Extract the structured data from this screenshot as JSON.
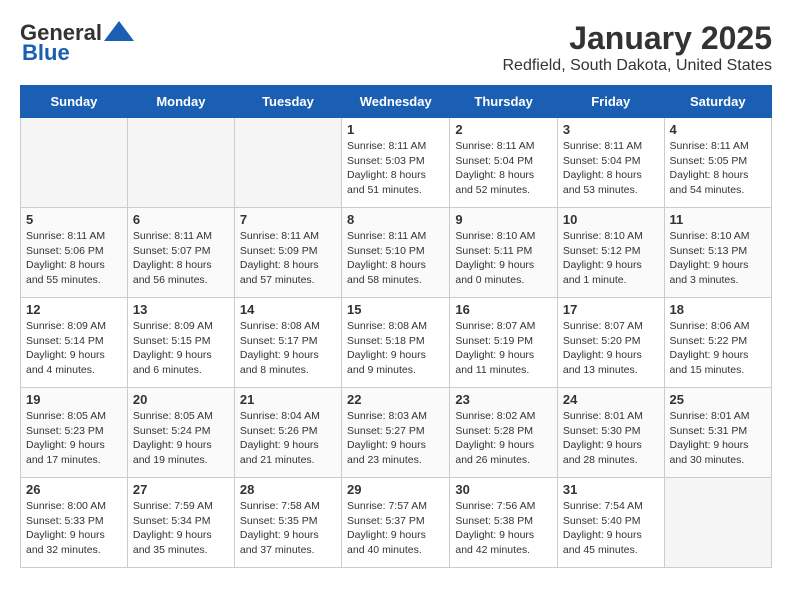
{
  "logo": {
    "text_general": "General",
    "text_blue": "Blue"
  },
  "header": {
    "title": "January 2025",
    "subtitle": "Redfield, South Dakota, United States"
  },
  "weekdays": [
    "Sunday",
    "Monday",
    "Tuesday",
    "Wednesday",
    "Thursday",
    "Friday",
    "Saturday"
  ],
  "weeks": [
    [
      {
        "day": "",
        "empty": true
      },
      {
        "day": "",
        "empty": true
      },
      {
        "day": "",
        "empty": true
      },
      {
        "day": "1",
        "sunrise": "8:11 AM",
        "sunset": "5:03 PM",
        "daylight": "8 hours and 51 minutes."
      },
      {
        "day": "2",
        "sunrise": "8:11 AM",
        "sunset": "5:04 PM",
        "daylight": "8 hours and 52 minutes."
      },
      {
        "day": "3",
        "sunrise": "8:11 AM",
        "sunset": "5:04 PM",
        "daylight": "8 hours and 53 minutes."
      },
      {
        "day": "4",
        "sunrise": "8:11 AM",
        "sunset": "5:05 PM",
        "daylight": "8 hours and 54 minutes."
      }
    ],
    [
      {
        "day": "5",
        "sunrise": "8:11 AM",
        "sunset": "5:06 PM",
        "daylight": "8 hours and 55 minutes."
      },
      {
        "day": "6",
        "sunrise": "8:11 AM",
        "sunset": "5:07 PM",
        "daylight": "8 hours and 56 minutes."
      },
      {
        "day": "7",
        "sunrise": "8:11 AM",
        "sunset": "5:09 PM",
        "daylight": "8 hours and 57 minutes."
      },
      {
        "day": "8",
        "sunrise": "8:11 AM",
        "sunset": "5:10 PM",
        "daylight": "8 hours and 58 minutes."
      },
      {
        "day": "9",
        "sunrise": "8:10 AM",
        "sunset": "5:11 PM",
        "daylight": "9 hours and 0 minutes."
      },
      {
        "day": "10",
        "sunrise": "8:10 AM",
        "sunset": "5:12 PM",
        "daylight": "9 hours and 1 minute."
      },
      {
        "day": "11",
        "sunrise": "8:10 AM",
        "sunset": "5:13 PM",
        "daylight": "9 hours and 3 minutes."
      }
    ],
    [
      {
        "day": "12",
        "sunrise": "8:09 AM",
        "sunset": "5:14 PM",
        "daylight": "9 hours and 4 minutes."
      },
      {
        "day": "13",
        "sunrise": "8:09 AM",
        "sunset": "5:15 PM",
        "daylight": "9 hours and 6 minutes."
      },
      {
        "day": "14",
        "sunrise": "8:08 AM",
        "sunset": "5:17 PM",
        "daylight": "9 hours and 8 minutes."
      },
      {
        "day": "15",
        "sunrise": "8:08 AM",
        "sunset": "5:18 PM",
        "daylight": "9 hours and 9 minutes."
      },
      {
        "day": "16",
        "sunrise": "8:07 AM",
        "sunset": "5:19 PM",
        "daylight": "9 hours and 11 minutes."
      },
      {
        "day": "17",
        "sunrise": "8:07 AM",
        "sunset": "5:20 PM",
        "daylight": "9 hours and 13 minutes."
      },
      {
        "day": "18",
        "sunrise": "8:06 AM",
        "sunset": "5:22 PM",
        "daylight": "9 hours and 15 minutes."
      }
    ],
    [
      {
        "day": "19",
        "sunrise": "8:05 AM",
        "sunset": "5:23 PM",
        "daylight": "9 hours and 17 minutes."
      },
      {
        "day": "20",
        "sunrise": "8:05 AM",
        "sunset": "5:24 PM",
        "daylight": "9 hours and 19 minutes."
      },
      {
        "day": "21",
        "sunrise": "8:04 AM",
        "sunset": "5:26 PM",
        "daylight": "9 hours and 21 minutes."
      },
      {
        "day": "22",
        "sunrise": "8:03 AM",
        "sunset": "5:27 PM",
        "daylight": "9 hours and 23 minutes."
      },
      {
        "day": "23",
        "sunrise": "8:02 AM",
        "sunset": "5:28 PM",
        "daylight": "9 hours and 26 minutes."
      },
      {
        "day": "24",
        "sunrise": "8:01 AM",
        "sunset": "5:30 PM",
        "daylight": "9 hours and 28 minutes."
      },
      {
        "day": "25",
        "sunrise": "8:01 AM",
        "sunset": "5:31 PM",
        "daylight": "9 hours and 30 minutes."
      }
    ],
    [
      {
        "day": "26",
        "sunrise": "8:00 AM",
        "sunset": "5:33 PM",
        "daylight": "9 hours and 32 minutes."
      },
      {
        "day": "27",
        "sunrise": "7:59 AM",
        "sunset": "5:34 PM",
        "daylight": "9 hours and 35 minutes."
      },
      {
        "day": "28",
        "sunrise": "7:58 AM",
        "sunset": "5:35 PM",
        "daylight": "9 hours and 37 minutes."
      },
      {
        "day": "29",
        "sunrise": "7:57 AM",
        "sunset": "5:37 PM",
        "daylight": "9 hours and 40 minutes."
      },
      {
        "day": "30",
        "sunrise": "7:56 AM",
        "sunset": "5:38 PM",
        "daylight": "9 hours and 42 minutes."
      },
      {
        "day": "31",
        "sunrise": "7:54 AM",
        "sunset": "5:40 PM",
        "daylight": "9 hours and 45 minutes."
      },
      {
        "day": "",
        "empty": true
      }
    ]
  ]
}
